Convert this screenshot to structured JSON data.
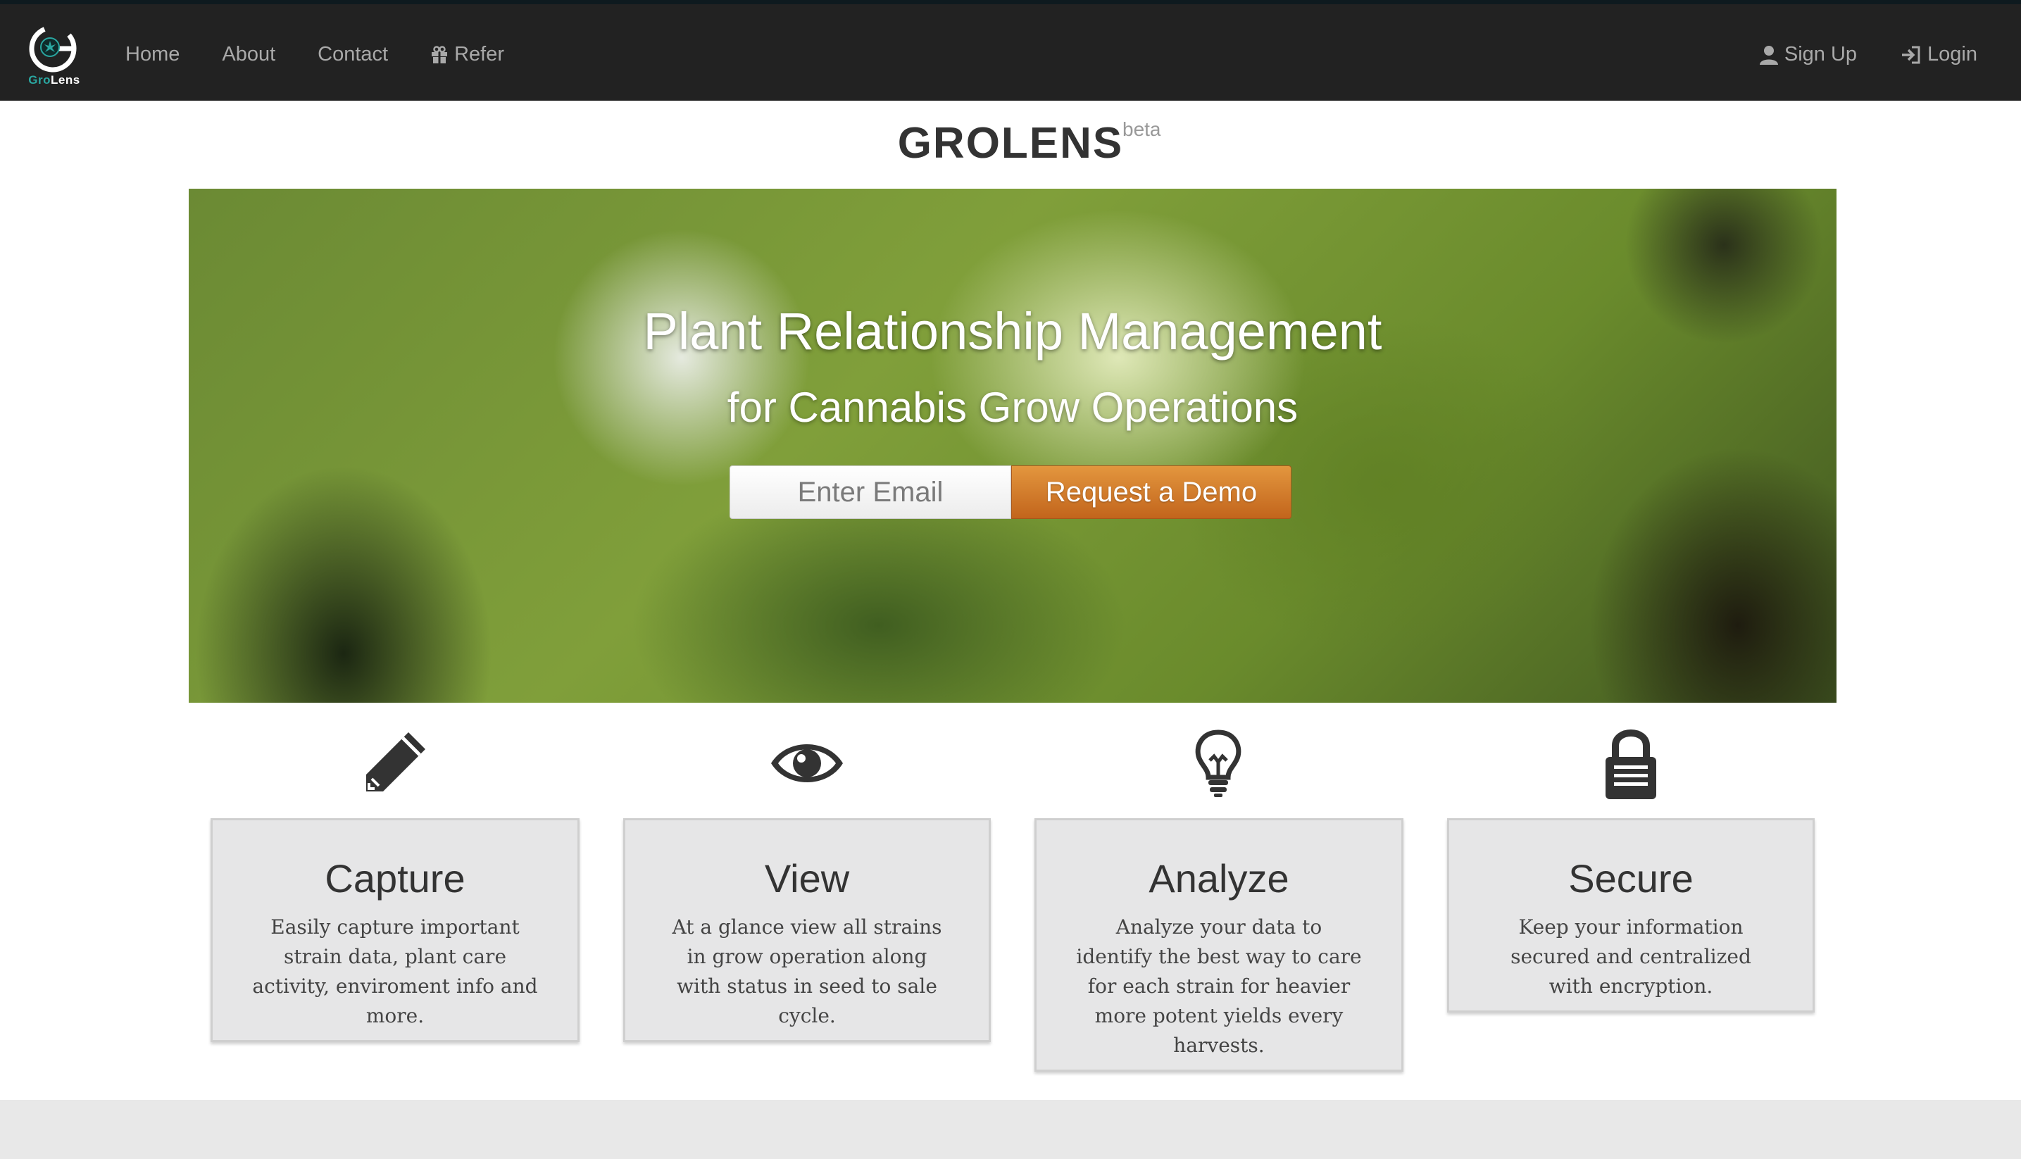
{
  "brand": {
    "logo_text_gro": "Gro",
    "logo_text_lens": "Lens"
  },
  "nav": {
    "left": [
      {
        "label": "Home"
      },
      {
        "label": "About"
      },
      {
        "label": "Contact"
      },
      {
        "label": "Refer",
        "icon": "gift-icon"
      }
    ],
    "right": [
      {
        "label": "Sign Up",
        "icon": "user-icon"
      },
      {
        "label": "Login",
        "icon": "login-icon"
      }
    ]
  },
  "page": {
    "title": "GROLENS",
    "badge": "beta"
  },
  "hero": {
    "title": "Plant Relationship Management",
    "subtitle": "for Cannabis Grow Operations",
    "email_placeholder": "Enter Email",
    "button_label": "Request a Demo"
  },
  "features": [
    {
      "icon": "pencil-icon",
      "title": "Capture",
      "description": "Easily capture important strain data, plant care activity, enviroment info and more."
    },
    {
      "icon": "eye-icon",
      "title": "View",
      "description": "At a glance view all strains in grow operation along with status in seed to sale cycle."
    },
    {
      "icon": "lightbulb-icon",
      "title": "Analyze",
      "description": "Analyze your data to identify the best way to care for each strain for heavier more potent yields every harvests."
    },
    {
      "icon": "lock-icon",
      "title": "Secure",
      "description": "Keep your information secured and centralized with encryption."
    }
  ],
  "colors": {
    "navbar": "#222222",
    "accent_button": "#d07f2c",
    "card_bg": "#e6e6e7"
  }
}
